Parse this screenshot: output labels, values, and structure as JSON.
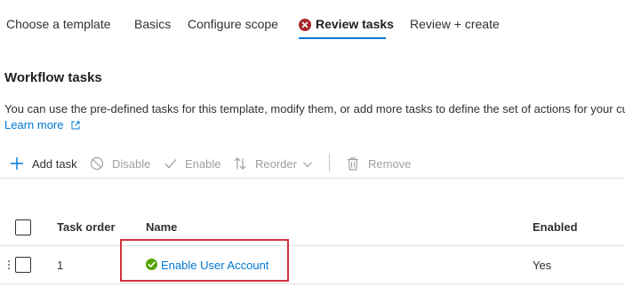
{
  "tabs": [
    {
      "label": "Choose a template"
    },
    {
      "label": "Basics"
    },
    {
      "label": "Configure scope"
    },
    {
      "label": "Review tasks",
      "status": "error"
    },
    {
      "label": "Review + create"
    }
  ],
  "section": {
    "title": "Workflow tasks",
    "description": "You can use the pre-defined tasks for this template, modify them, or add more tasks to define the set of actions for your cu",
    "learn_more": "Learn more"
  },
  "toolbar": {
    "add_task": "Add task",
    "disable": "Disable",
    "enable": "Enable",
    "reorder": "Reorder",
    "remove": "Remove"
  },
  "grid": {
    "headers": {
      "task_order": "Task order",
      "name": "Name",
      "enabled": "Enabled"
    },
    "rows": [
      {
        "task_order": "1",
        "name": "Enable User Account",
        "status": "success",
        "enabled": "Yes"
      }
    ]
  },
  "colors": {
    "accent": "#0078d4",
    "error": "#a4262c",
    "success": "#57a300",
    "highlight": "#d13438"
  },
  "icons": {
    "tab_status": "error-circle-icon",
    "row_status": "check-circle-icon",
    "add": "plus-icon",
    "disable": "block-icon",
    "enable": "checkmark-icon",
    "reorder": "reorder-arrows-icon",
    "remove": "trash-icon",
    "external": "external-link-icon"
  }
}
